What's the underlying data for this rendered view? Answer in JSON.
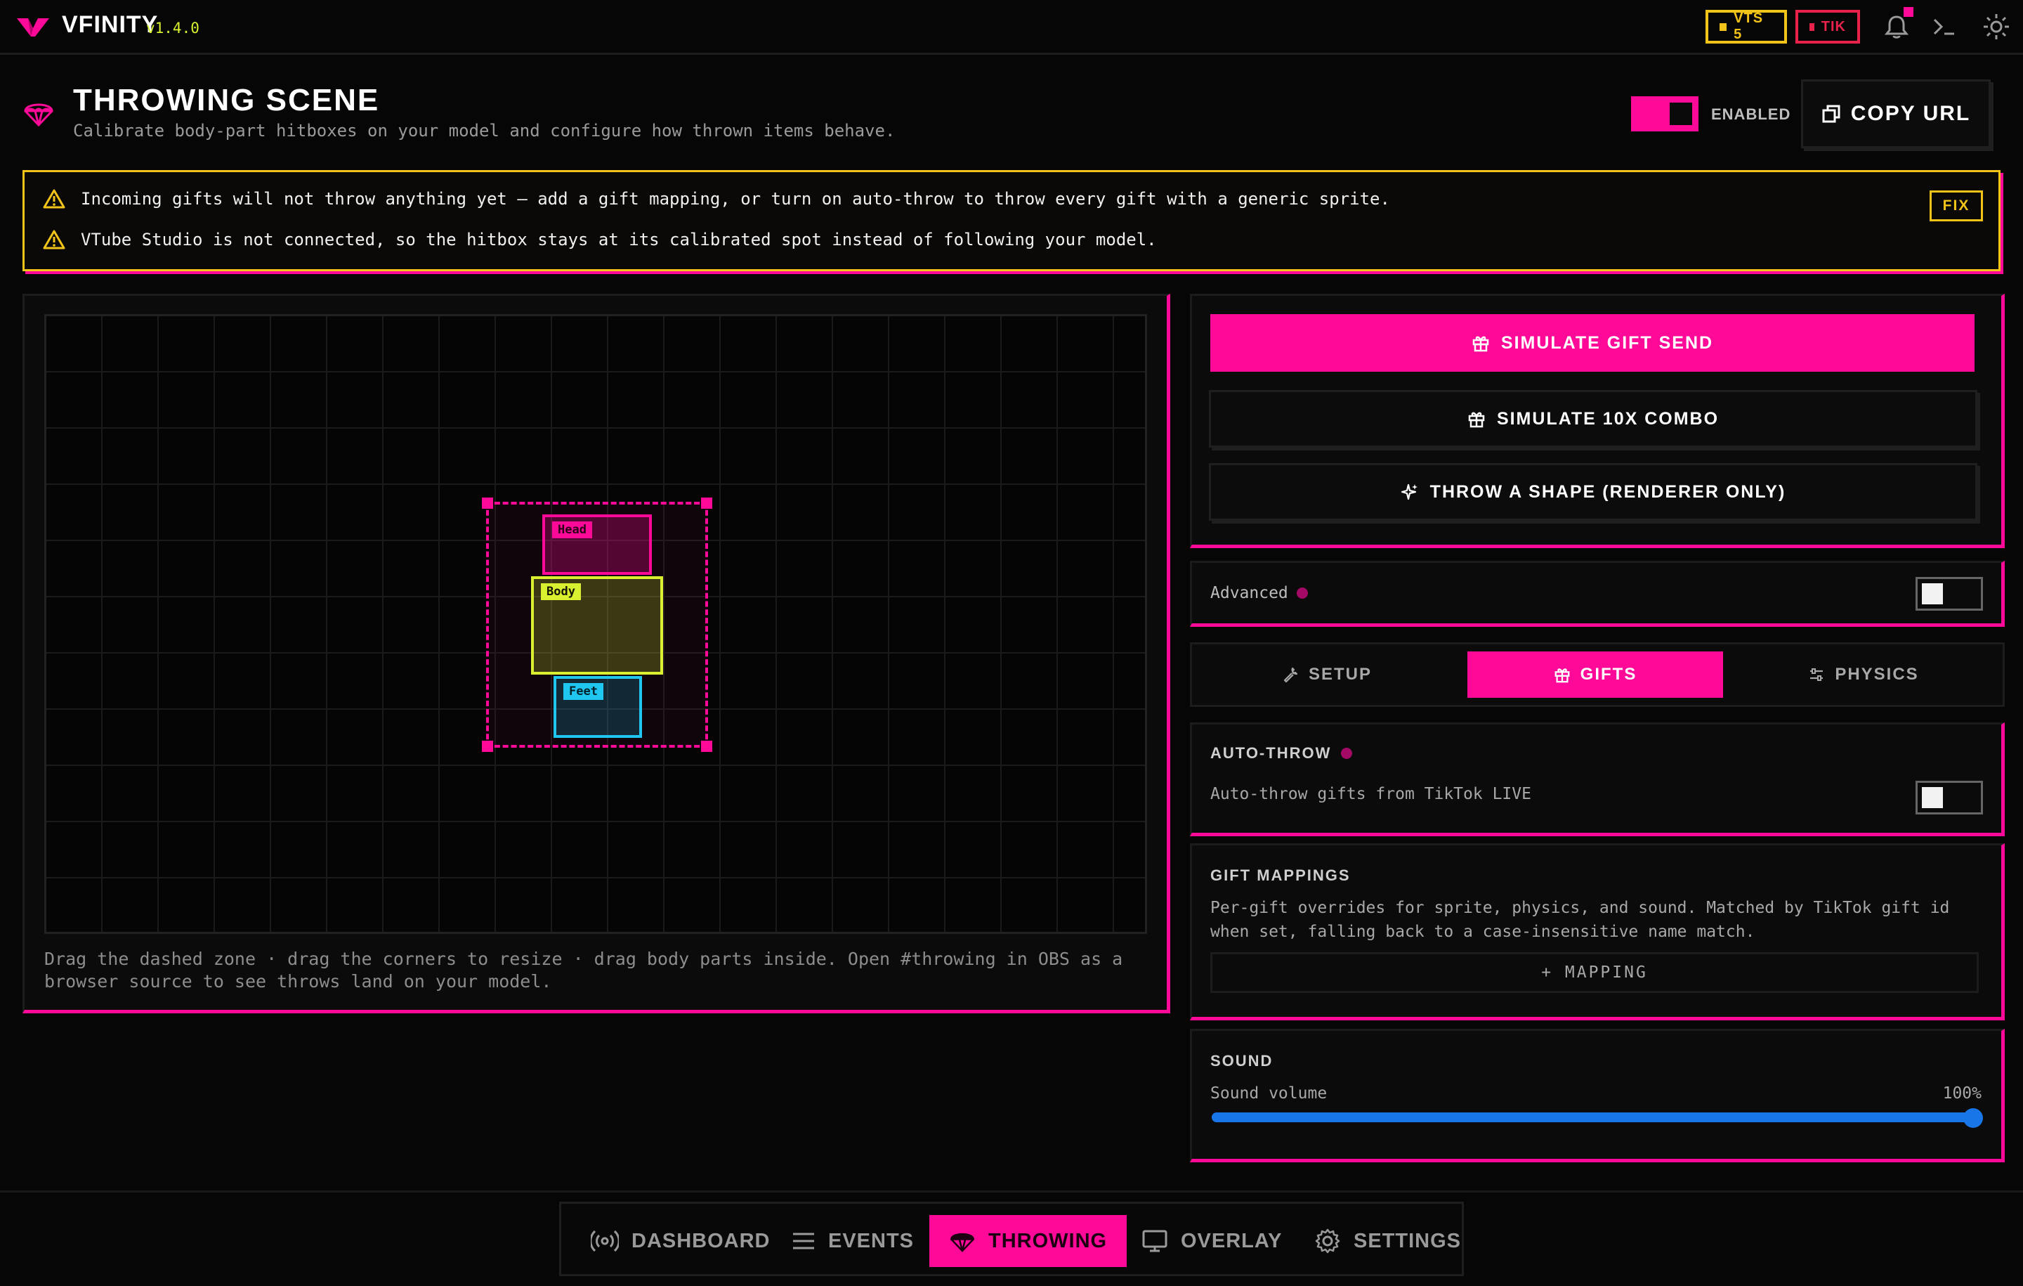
{
  "app": {
    "name": "VFINITY",
    "version": "v1.4.0"
  },
  "status": {
    "vts_label": "VTS 5",
    "tik_label": "TIK",
    "vts_color": "#f2c41a",
    "tik_color": "#e8224a"
  },
  "colors": {
    "accent": "#ff0a98",
    "warning": "#f2c41a",
    "body_part": "#d8f030",
    "feet_part": "#1ec6f0",
    "slider": "#1976e8"
  },
  "header": {
    "title": "THROWING SCENE",
    "subtitle": "Calibrate body-part hitboxes on your model and configure how thrown items behave.",
    "enabled_label": "ENABLED",
    "enabled": true,
    "copy_url_label": "COPY URL"
  },
  "warnings": {
    "items": [
      "Incoming gifts will not throw anything yet — add a gift mapping, or turn on auto-throw to throw every gift with a generic sprite.",
      "VTube Studio is not connected, so the hitbox stays at its calibrated spot instead of following your model."
    ],
    "fix_label": "FIX"
  },
  "canvas": {
    "parts": [
      "Head",
      "Body",
      "Feet"
    ],
    "hint": "Drag the dashed zone · drag the corners to resize · drag body parts inside. Open #throwing in OBS as a browser source to see throws land on your model."
  },
  "actions": {
    "simulate_gift": "SIMULATE GIFT SEND",
    "simulate_combo": "SIMULATE 10X COMBO",
    "throw_shape": "THROW A SHAPE (RENDERER ONLY)"
  },
  "advanced": {
    "label": "Advanced",
    "enabled": false
  },
  "tabs": [
    {
      "label": "SETUP",
      "icon": "wrench-icon",
      "active": false
    },
    {
      "label": "GIFTS",
      "icon": "gift-icon",
      "active": true
    },
    {
      "label": "PHYSICS",
      "icon": "sliders-icon",
      "active": false
    }
  ],
  "auto_throw": {
    "title": "AUTO-THROW",
    "label": "Auto-throw gifts from TikTok LIVE",
    "enabled": false
  },
  "gift_mappings": {
    "title": "GIFT MAPPINGS",
    "description": "Per-gift overrides for sprite, physics, and sound. Matched by TikTok gift id when set, falling back to a case-insensitive name match.",
    "add_label": "+ MAPPING"
  },
  "sound": {
    "title": "SOUND",
    "volume_label": "Sound volume",
    "volume_value": "100%",
    "volume_fraction": 1.0
  },
  "nav": [
    {
      "label": "DASHBOARD",
      "icon": "broadcast-icon",
      "active": false
    },
    {
      "label": "EVENTS",
      "icon": "menu-lines-icon",
      "active": false
    },
    {
      "label": "THROWING",
      "icon": "parachute-icon",
      "active": true
    },
    {
      "label": "OVERLAY",
      "icon": "monitor-icon",
      "active": false
    },
    {
      "label": "SETTINGS",
      "icon": "gear-icon",
      "active": false
    }
  ]
}
